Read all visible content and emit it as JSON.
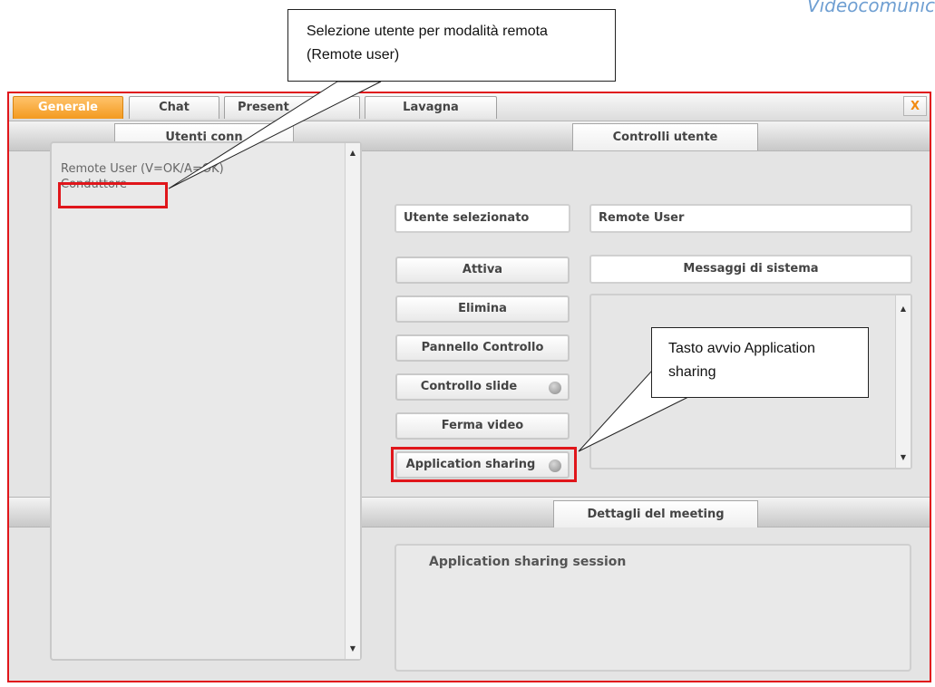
{
  "header": {
    "brand_text": "Videocomunic"
  },
  "callouts": {
    "user_selection": "Selezione utente per modalità remota (Remote user)",
    "app_sharing": "Tasto avvio Application sharing"
  },
  "tabs": {
    "items": [
      {
        "label": "Generale",
        "active": true
      },
      {
        "label": "Chat",
        "active": false
      },
      {
        "label": "Present",
        "active": false
      },
      {
        "label": "Lavagna",
        "active": false
      }
    ],
    "close_label": "X"
  },
  "users_panel": {
    "header": "Utenti conn",
    "items": [
      "Remote User (V=OK/A=OK)",
      "Conduttore"
    ]
  },
  "controls": {
    "header": "Controlli utente",
    "selected_user_label": "Utente selezionato",
    "selected_user_value": "Remote User",
    "system_messages_label": "Messaggi di sistema",
    "buttons": {
      "attiva": "Attiva",
      "elimina": "Elimina",
      "pannello_controllo": "Pannello Controllo",
      "controllo_slide": "Controllo slide",
      "ferma_video": "Ferma video",
      "application_sharing": "Application sharing"
    }
  },
  "meeting": {
    "header": "Dettagli del meeting",
    "details_text": "Application sharing session"
  },
  "colors": {
    "highlight": "#e0161b",
    "active_tab": "#f39a1f",
    "header_text": "#6f9fd2"
  }
}
